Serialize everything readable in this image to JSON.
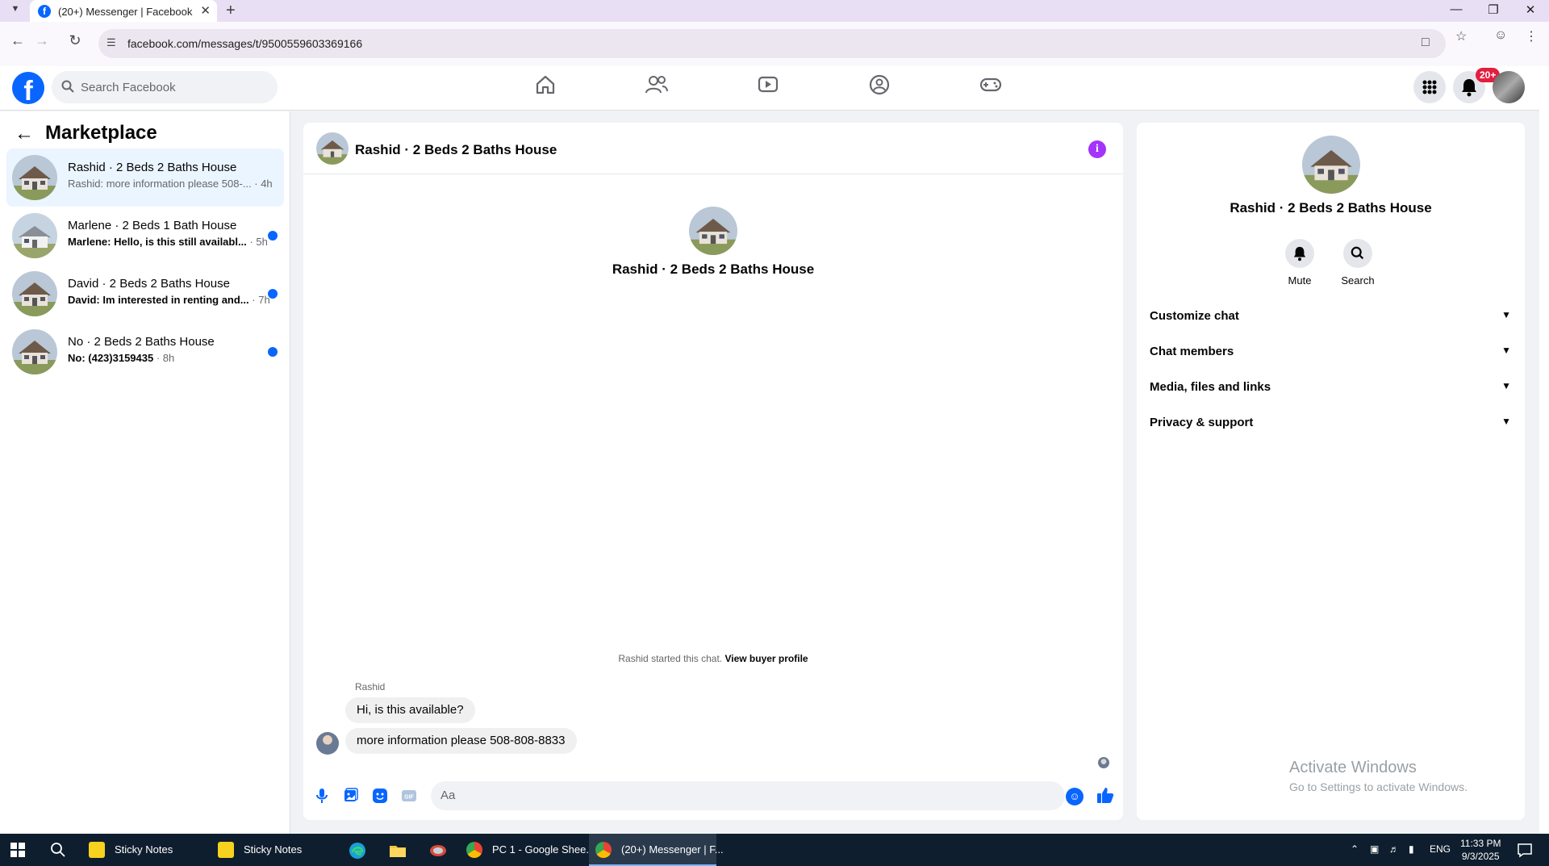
{
  "browser": {
    "tab_title": "(20+) Messenger | Facebook",
    "url": "facebook.com/messages/t/9500559603369166"
  },
  "facebook": {
    "search_placeholder": "Search Facebook",
    "notifications_badge": "20+"
  },
  "sidebar": {
    "title": "Marketplace",
    "conversations": [
      {
        "name": "Rashid · 2 Beds 2 Baths House",
        "preview": "Rashid: more information please 508-...",
        "time": "· 4h",
        "unread": false,
        "active": true
      },
      {
        "name": "Marlene · 2 Beds 1 Bath House",
        "preview": "Marlene: Hello, is this still availabl...",
        "time": "· 5h",
        "unread": true,
        "active": false
      },
      {
        "name": "David · 2 Beds 2 Baths House",
        "preview": "David: Im interested in renting and...",
        "time": "· 7h",
        "unread": true,
        "active": false
      },
      {
        "name": "No · 2 Beds 2 Baths House",
        "preview": "No: (423)3159435",
        "time": "· 8h",
        "unread": true,
        "active": false
      }
    ]
  },
  "chat": {
    "header_title": "Rashid · 2 Beds 2 Baths House",
    "intro_title": "Rashid · 2 Beds 2 Baths House",
    "started_text": "Rashid started this chat.",
    "view_profile": "View buyer profile",
    "sender": "Rashid",
    "messages": [
      "Hi, is this available?",
      "more information please 508-808-8833"
    ],
    "composer_placeholder": "Aa"
  },
  "details": {
    "title": "Rashid · 2 Beds 2 Baths House",
    "actions": [
      "Mute",
      "Search"
    ],
    "sections": [
      "Customize chat",
      "Chat members",
      "Media, files and links",
      "Privacy & support"
    ]
  },
  "watermark": {
    "line1": "Activate Windows",
    "line2": "Go to Settings to activate Windows."
  },
  "taskbar": {
    "apps": [
      "Sticky Notes",
      "Sticky Notes",
      "PC 1 - Google Shee...",
      "(20+) Messenger | F..."
    ],
    "language": "ENG",
    "time": "11:33 PM",
    "date": "9/3/2025"
  },
  "colors": {
    "fb_blue": "#0866ff",
    "unread_dot": "#0866ff",
    "badge_red": "#e41e3f",
    "active_row": "#ebf5ff"
  }
}
